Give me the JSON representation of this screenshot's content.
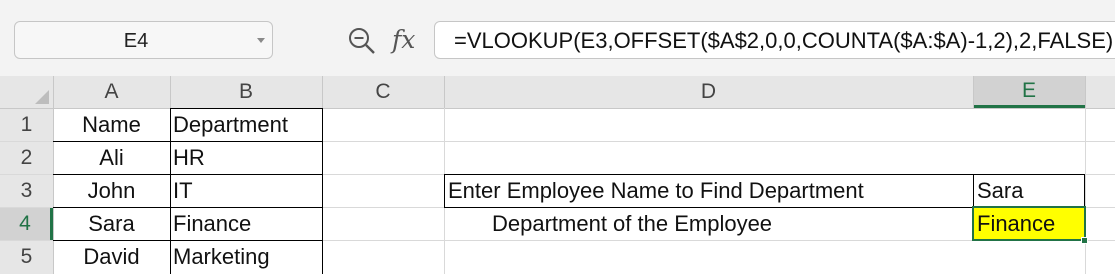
{
  "name_box": {
    "value": "E4"
  },
  "formula_bar": {
    "formula": "=VLOOKUP(E3,OFFSET($A$2,0,0,COUNTA($A:$A)-1,2),2,FALSE)"
  },
  "columns": [
    "A",
    "B",
    "C",
    "D",
    "E"
  ],
  "rows": [
    "1",
    "2",
    "3",
    "4",
    "5"
  ],
  "cells": {
    "A1": "Name",
    "B1": "Department",
    "A2": "Ali",
    "B2": "HR",
    "A3": "John",
    "B3": "IT",
    "A4": "Sara",
    "B4": "Finance",
    "A5": "David",
    "B5": "Marketing",
    "D3": "Enter Employee Name to Find Department",
    "E3": "Sara",
    "D4": "Department of the Employee",
    "E4": "Finance"
  },
  "selected_cell": "E4",
  "colors": {
    "accent": "#217346",
    "highlight_fill": "#ffff00"
  }
}
